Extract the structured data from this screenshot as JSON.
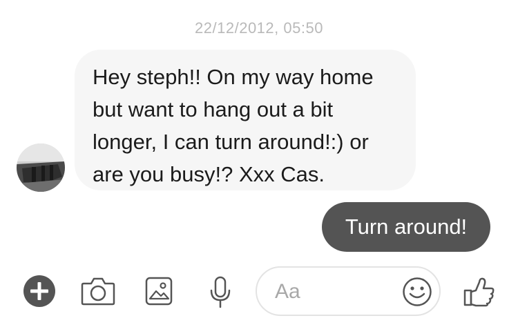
{
  "conversation": {
    "timestamp": "22/12/2012, 05:50",
    "incoming": {
      "line1": "Hey steph!! On my way home",
      "line2": "but want to hang out a bit",
      "line3": "longer, I can turn around!:) or",
      "line4": "are you busy!? Xxx Cas."
    },
    "outgoing": {
      "text": "Turn around!"
    }
  },
  "composer": {
    "placeholder": "Aa"
  },
  "icons": {
    "add": "plus-circle-icon",
    "camera": "camera-icon",
    "gallery": "image-icon",
    "microphone": "microphone-icon",
    "emoji": "smiley-icon",
    "like": "thumbs-up-icon"
  },
  "colors": {
    "outgoing_bubble": "#545454",
    "incoming_bubble": "#f6f6f6",
    "icon": "#545454",
    "timestamp": "#b9b9b9"
  }
}
